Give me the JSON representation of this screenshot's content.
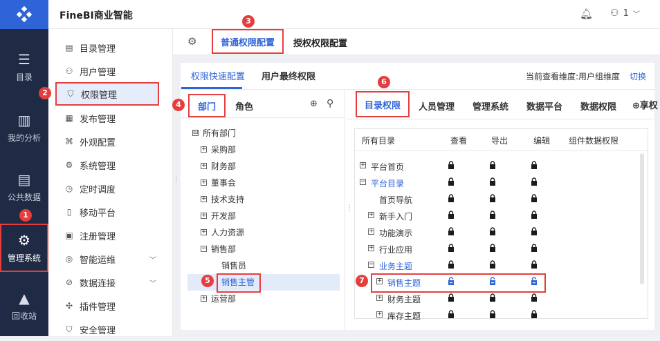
{
  "app": {
    "title": "FineBI商业智能",
    "user": "1"
  },
  "leftnav": [
    {
      "label": "目录"
    },
    {
      "label": "我的分析"
    },
    {
      "label": "公共数据"
    },
    {
      "label": "管理系统"
    },
    {
      "label": "回收站"
    }
  ],
  "menu": [
    {
      "label": "目录管理"
    },
    {
      "label": "用户管理"
    },
    {
      "label": "权限管理"
    },
    {
      "label": "发布管理"
    },
    {
      "label": "外观配置"
    },
    {
      "label": "系统管理"
    },
    {
      "label": "定时调度"
    },
    {
      "label": "移动平台"
    },
    {
      "label": "注册管理"
    },
    {
      "label": "智能运维"
    },
    {
      "label": "数据连接"
    },
    {
      "label": "插件管理"
    },
    {
      "label": "安全管理"
    }
  ],
  "tabs1": {
    "normal": "普通权限配置",
    "grant": "授权权限配置"
  },
  "tabs2": {
    "quick": "权限快速配置",
    "final": "用户最终权限",
    "dimension": "当前查看维度:用户组维度",
    "switch": "切换"
  },
  "left_tabs": {
    "dept": "部门",
    "role": "角色"
  },
  "right_tabs": [
    "目录权限",
    "人员管理",
    "管理系统",
    "数据平台",
    "数据权限",
    "享权"
  ],
  "tree": [
    {
      "label": "所有部门",
      "sign": "⊟",
      "indent": 0
    },
    {
      "label": "采购部",
      "sign": "+",
      "indent": 1
    },
    {
      "label": "财务部",
      "sign": "+",
      "indent": 1
    },
    {
      "label": "董事会",
      "sign": "+",
      "indent": 1
    },
    {
      "label": "技术支持",
      "sign": "+",
      "indent": 1
    },
    {
      "label": "开发部",
      "sign": "+",
      "indent": 1
    },
    {
      "label": "人力资源",
      "sign": "+",
      "indent": 1
    },
    {
      "label": "销售部",
      "sign": "−",
      "indent": 1
    },
    {
      "label": "销售员",
      "sign": "",
      "indent": 2
    },
    {
      "label": "销售主管",
      "sign": "",
      "indent": 2
    },
    {
      "label": "运营部",
      "sign": "+",
      "indent": 1
    }
  ],
  "table": {
    "headers": [
      "所有目录",
      "查看",
      "导出",
      "编辑",
      "组件数据权限"
    ],
    "rows": [
      {
        "label": "平台首页",
        "sign": "+",
        "indent": 0
      },
      {
        "label": "平台目录",
        "sign": "−",
        "indent": 0
      },
      {
        "label": "首页导航",
        "sign": "",
        "indent": 1
      },
      {
        "label": "新手入门",
        "sign": "+",
        "indent": 1
      },
      {
        "label": "功能演示",
        "sign": "+",
        "indent": 1
      },
      {
        "label": "行业应用",
        "sign": "+",
        "indent": 1
      },
      {
        "label": "业务主题",
        "sign": "−",
        "indent": 1
      },
      {
        "label": "销售主题",
        "sign": "+",
        "indent": 2
      },
      {
        "label": "财务主题",
        "sign": "+",
        "indent": 2
      },
      {
        "label": "库存主题",
        "sign": "+",
        "indent": 2
      }
    ]
  },
  "badges": [
    "1",
    "2",
    "3",
    "4",
    "5",
    "6",
    "7"
  ]
}
